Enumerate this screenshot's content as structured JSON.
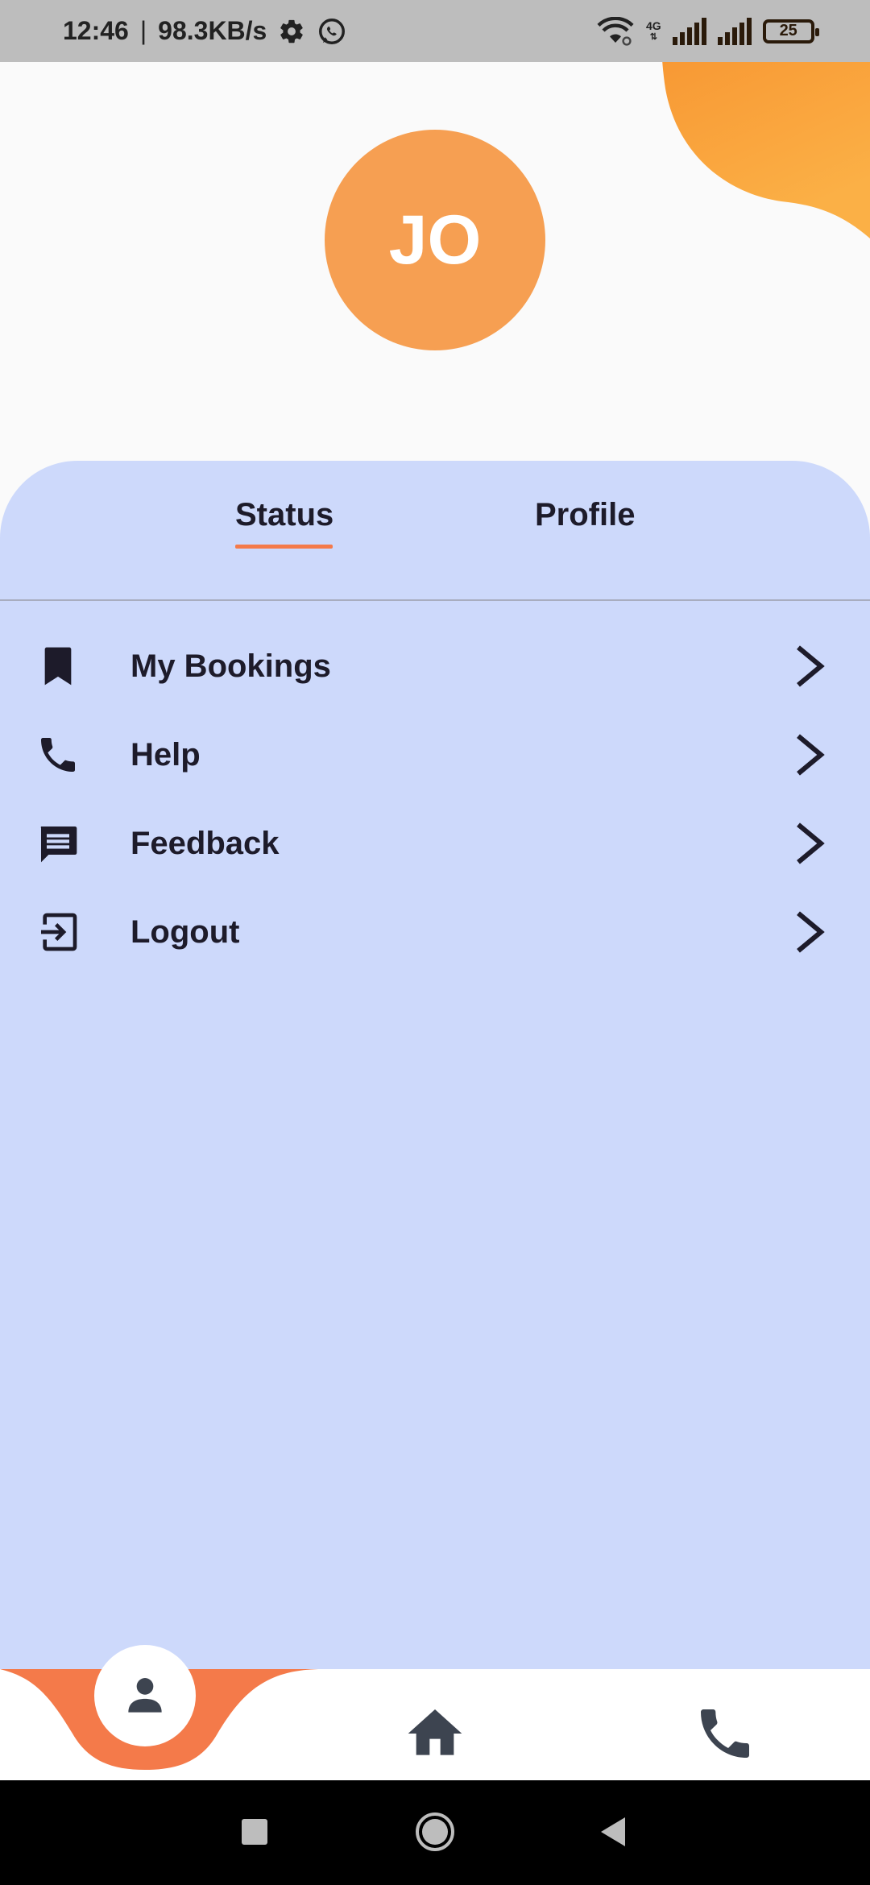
{
  "status_bar": {
    "time": "12:46",
    "separator": "|",
    "speed": "98.3KB/s",
    "network": "4G",
    "battery": "25",
    "icons": [
      "gear-icon",
      "whatsapp-icon",
      "wifi-icon",
      "signal-icon",
      "battery-icon"
    ]
  },
  "avatar": {
    "initials": "JO"
  },
  "tabs": {
    "status": "Status",
    "profile": "Profile",
    "active": "Status"
  },
  "menu": {
    "items": [
      {
        "label": "My Bookings",
        "icon": "bookmark-icon"
      },
      {
        "label": "Help",
        "icon": "phone-icon"
      },
      {
        "label": "Feedback",
        "icon": "chat-icon"
      },
      {
        "label": "Logout",
        "icon": "logout-icon"
      }
    ]
  },
  "bottom_nav": {
    "items": [
      "person-icon",
      "home-icon",
      "phone-icon"
    ],
    "active": "person-icon"
  },
  "system_nav": {
    "items": [
      "recents-icon",
      "home-circle-icon",
      "back-icon"
    ]
  },
  "colors": {
    "accent_orange": "#f47a4a",
    "avatar_bg": "#f69f52",
    "panel_bg": "#cdd9fb",
    "text_dark": "#1d1b2a"
  }
}
